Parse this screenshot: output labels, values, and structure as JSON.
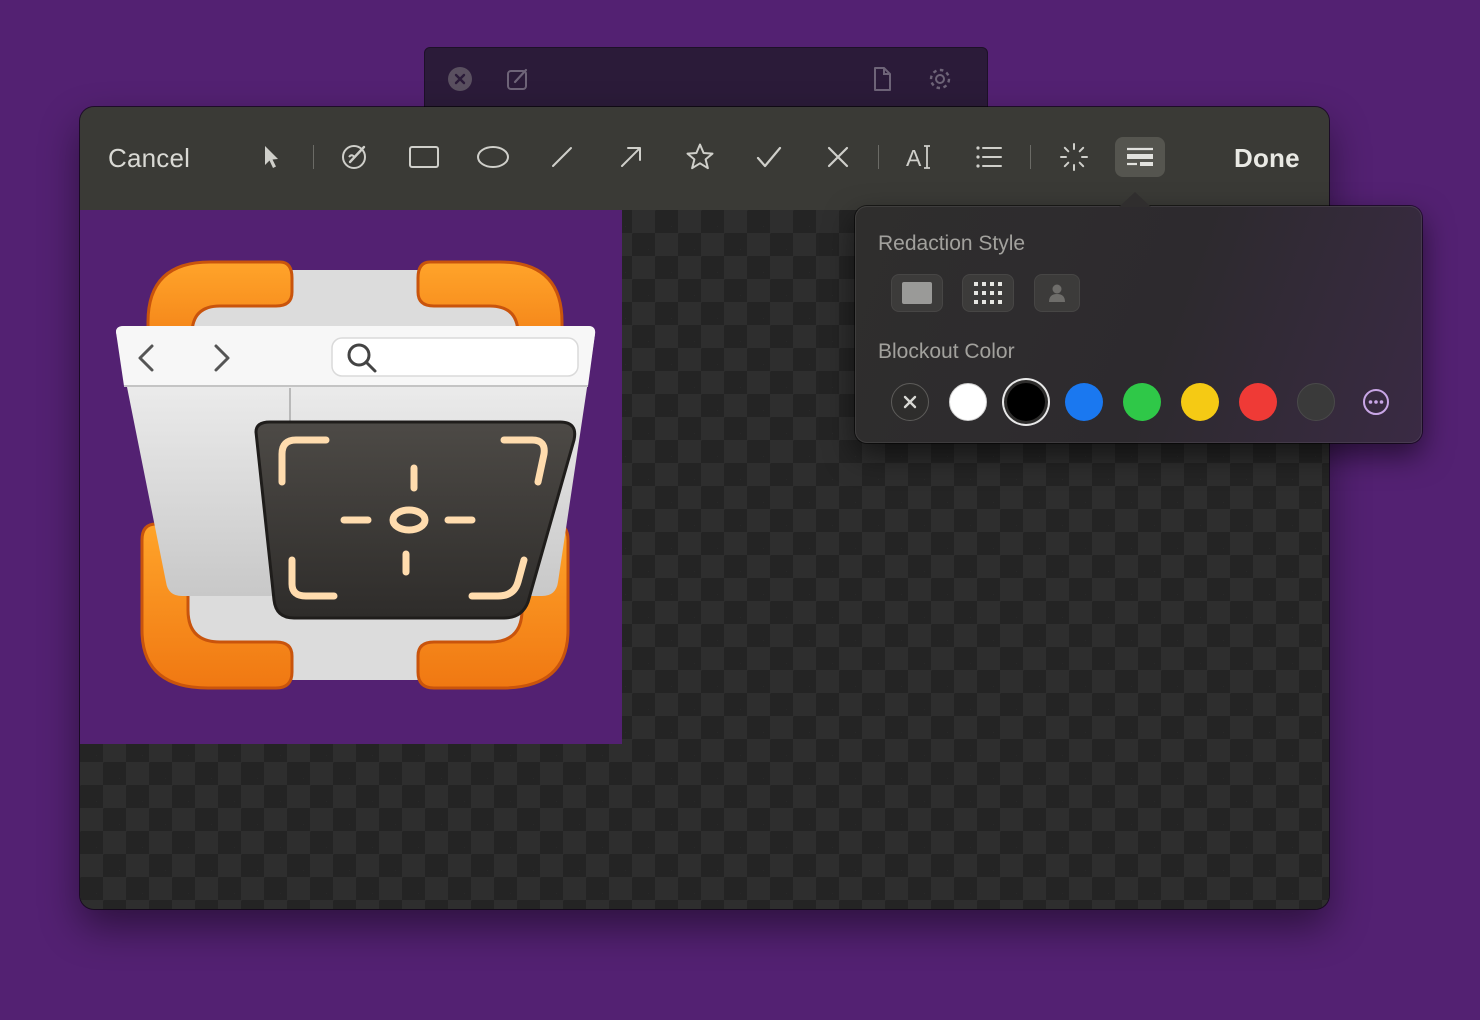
{
  "background_window": {
    "icons": [
      "close-circle-icon",
      "compose-icon",
      "document-icon",
      "gear-icon"
    ]
  },
  "toolbar": {
    "cancel_label": "Cancel",
    "done_label": "Done",
    "text_tool_glyph": "A",
    "tools": [
      "pointer-icon",
      "sketch-icon",
      "rectangle-icon",
      "oval-icon",
      "line-icon",
      "arrow-icon",
      "star-icon",
      "checkmark-icon",
      "x-mark-icon",
      "text-icon",
      "list-icon",
      "spotlight-icon",
      "redact-icon"
    ],
    "active_tool": "redact-icon"
  },
  "popover": {
    "redaction_style_title": "Redaction Style",
    "redaction_styles": [
      "solid-block-icon",
      "pixelate-icon",
      "blur-person-icon"
    ],
    "blockout_color_title": "Blockout Color",
    "colors": [
      {
        "name": "none",
        "hex": "none"
      },
      {
        "name": "white",
        "hex": "#ffffff"
      },
      {
        "name": "black",
        "hex": "#000000",
        "selected": true
      },
      {
        "name": "blue",
        "hex": "#1a78f0"
      },
      {
        "name": "green",
        "hex": "#2fc848"
      },
      {
        "name": "yellow",
        "hex": "#f5ca14"
      },
      {
        "name": "red",
        "hex": "#ef3a36"
      },
      {
        "name": "dark-gray",
        "hex": "#3a3a3a"
      }
    ],
    "more_colors_icon": "ellipsis-circle-icon"
  },
  "canvas": {
    "image_background": "#532172",
    "app_icon": "screenshot-browser-app-icon"
  }
}
